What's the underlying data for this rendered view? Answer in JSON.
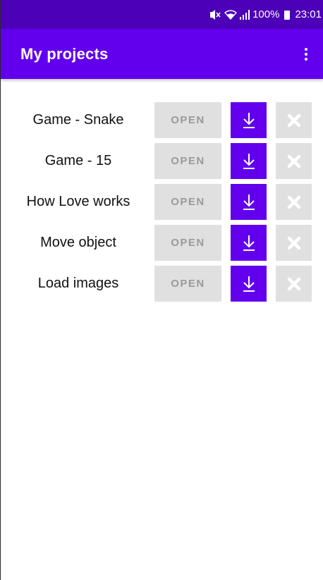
{
  "status_bar": {
    "mute_icon": "mute-vibrate-icon",
    "wifi_icon": "wifi-icon",
    "signal_icon": "signal-icon",
    "battery_text": "100%",
    "battery_icon": "battery-icon",
    "time": "23:01"
  },
  "app_bar": {
    "title": "My projects",
    "menu_icon": "more-vert-icon"
  },
  "projects": [
    {
      "name": "Game - Snake",
      "open_label": "OPEN"
    },
    {
      "name": "Game - 15",
      "open_label": "OPEN"
    },
    {
      "name": "How Love works",
      "open_label": "OPEN"
    },
    {
      "name": "Move object",
      "open_label": "OPEN"
    },
    {
      "name": "Load images",
      "open_label": "OPEN"
    }
  ],
  "colors": {
    "status_bar": "#4c00b8",
    "app_bar": "#6200ee",
    "accent": "#6200ee",
    "button_grey": "#e0e0e0",
    "button_text_grey": "#9a9a9a"
  }
}
